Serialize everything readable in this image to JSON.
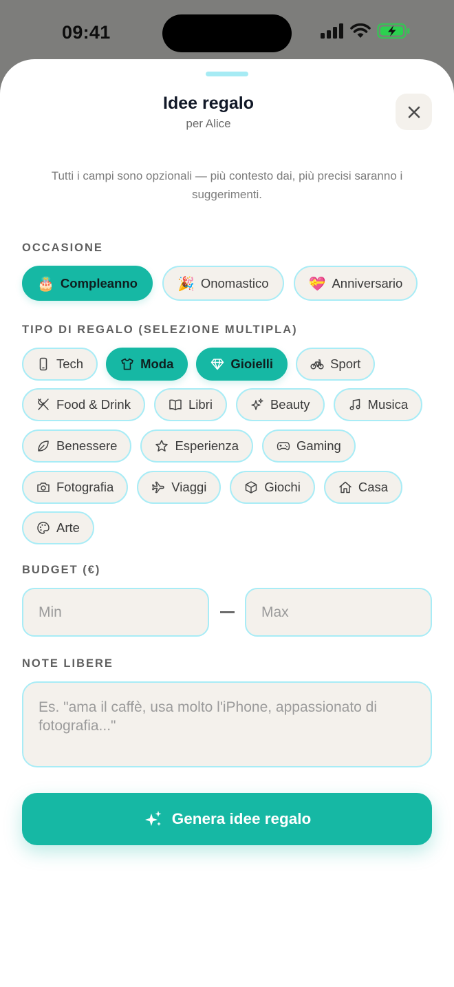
{
  "status": {
    "time": "09:41"
  },
  "sheet": {
    "title": "Idee regalo",
    "subtitle": "per Alice",
    "intro": "Tutti i campi sono opzionali — più contesto dai, più precisi saranno i suggerimenti."
  },
  "occasion": {
    "label": "OCCASIONE",
    "options": [
      {
        "label": "Compleanno",
        "emoji": "🎂",
        "selected": true
      },
      {
        "label": "Onomastico",
        "emoji": "🎉",
        "selected": false
      },
      {
        "label": "Anniversario",
        "emoji": "💝",
        "selected": false
      }
    ]
  },
  "gift_type": {
    "label": "TIPO DI REGALO (SELEZIONE MULTIPLA)",
    "options": [
      {
        "label": "Tech",
        "icon": "smartphone-icon",
        "selected": false
      },
      {
        "label": "Moda",
        "icon": "tshirt-icon",
        "selected": true
      },
      {
        "label": "Gioielli",
        "icon": "diamond-icon",
        "selected": true
      },
      {
        "label": "Sport",
        "icon": "bicycle-icon",
        "selected": false
      },
      {
        "label": "Food & Drink",
        "icon": "fork-knife-icon",
        "selected": false
      },
      {
        "label": "Libri",
        "icon": "book-icon",
        "selected": false
      },
      {
        "label": "Beauty",
        "icon": "sparkles-icon",
        "selected": false
      },
      {
        "label": "Musica",
        "icon": "music-note-icon",
        "selected": false
      },
      {
        "label": "Benessere",
        "icon": "leaf-icon",
        "selected": false
      },
      {
        "label": "Esperienza",
        "icon": "star-icon",
        "selected": false
      },
      {
        "label": "Gaming",
        "icon": "gamepad-icon",
        "selected": false
      },
      {
        "label": "Fotografia",
        "icon": "camera-icon",
        "selected": false
      },
      {
        "label": "Viaggi",
        "icon": "plane-icon",
        "selected": false
      },
      {
        "label": "Giochi",
        "icon": "cube-icon",
        "selected": false
      },
      {
        "label": "Casa",
        "icon": "house-icon",
        "selected": false
      },
      {
        "label": "Arte",
        "icon": "palette-icon",
        "selected": false
      }
    ]
  },
  "budget": {
    "label": "BUDGET (€)",
    "min_placeholder": "Min",
    "max_placeholder": "Max"
  },
  "notes": {
    "label": "NOTE LIBERE",
    "placeholder": "Es. \"ama il caffè, usa molto l'iPhone, appassionato di fotografia...\""
  },
  "generate_button": {
    "label": "Genera idee regalo"
  },
  "colors": {
    "accent": "#16b8a4",
    "chip_border": "#a8ecf6",
    "chip_bg": "#f4f1ec",
    "battery": "#2bd14f"
  }
}
